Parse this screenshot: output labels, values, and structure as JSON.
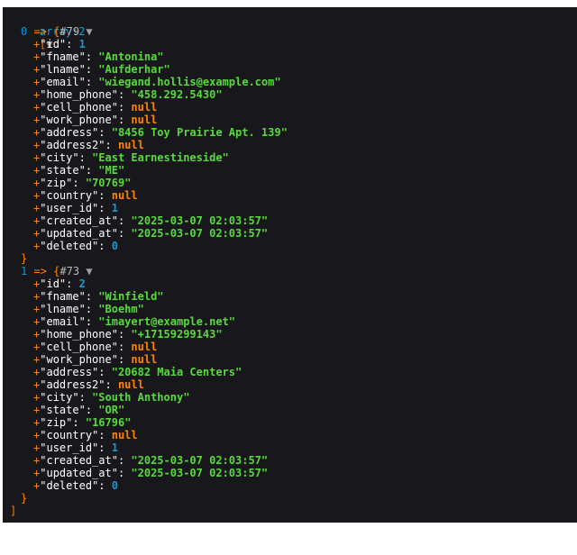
{
  "header": {
    "label": "array:2",
    "open_bracket": "[",
    "toggle": "▼",
    "close_bracket": "]"
  },
  "records": [
    {
      "index": "0",
      "arrow": "=>",
      "brace": "{",
      "ref": "#79",
      "toggle": "▼",
      "close": "}",
      "fields": [
        {
          "key": "id",
          "value": "1",
          "type": "num"
        },
        {
          "key": "fname",
          "value": "\"Antonina\"",
          "type": "str"
        },
        {
          "key": "lname",
          "value": "\"Aufderhar\"",
          "type": "str"
        },
        {
          "key": "email",
          "value": "\"wiegand.hollis@example.com\"",
          "type": "str"
        },
        {
          "key": "home_phone",
          "value": "\"458.292.5430\"",
          "type": "str"
        },
        {
          "key": "cell_phone",
          "value": "null",
          "type": "null"
        },
        {
          "key": "work_phone",
          "value": "null",
          "type": "null"
        },
        {
          "key": "address",
          "value": "\"8456 Toy Prairie Apt. 139\"",
          "type": "str"
        },
        {
          "key": "address2",
          "value": "null",
          "type": "null"
        },
        {
          "key": "city",
          "value": "\"East Earnestineside\"",
          "type": "str"
        },
        {
          "key": "state",
          "value": "\"ME\"",
          "type": "str"
        },
        {
          "key": "zip",
          "value": "\"70769\"",
          "type": "str"
        },
        {
          "key": "country",
          "value": "null",
          "type": "null"
        },
        {
          "key": "user_id",
          "value": "1",
          "type": "num"
        },
        {
          "key": "created_at",
          "value": "\"2025-03-07 02:03:57\"",
          "type": "str"
        },
        {
          "key": "updated_at",
          "value": "\"2025-03-07 02:03:57\"",
          "type": "str"
        },
        {
          "key": "deleted",
          "value": "0",
          "type": "num"
        }
      ]
    },
    {
      "index": "1",
      "arrow": "=>",
      "brace": "{",
      "ref": "#73",
      "toggle": "▼",
      "close": "}",
      "fields": [
        {
          "key": "id",
          "value": "2",
          "type": "num"
        },
        {
          "key": "fname",
          "value": "\"Winfield\"",
          "type": "str"
        },
        {
          "key": "lname",
          "value": "\"Boehm\"",
          "type": "str"
        },
        {
          "key": "email",
          "value": "\"imayert@example.net\"",
          "type": "str"
        },
        {
          "key": "home_phone",
          "value": "\"+17159299143\"",
          "type": "str"
        },
        {
          "key": "cell_phone",
          "value": "null",
          "type": "null"
        },
        {
          "key": "work_phone",
          "value": "null",
          "type": "null"
        },
        {
          "key": "address",
          "value": "\"20682 Maia Centers\"",
          "type": "str"
        },
        {
          "key": "address2",
          "value": "null",
          "type": "null"
        },
        {
          "key": "city",
          "value": "\"South Anthony\"",
          "type": "str"
        },
        {
          "key": "state",
          "value": "\"OR\"",
          "type": "str"
        },
        {
          "key": "zip",
          "value": "\"16796\"",
          "type": "str"
        },
        {
          "key": "country",
          "value": "null",
          "type": "null"
        },
        {
          "key": "user_id",
          "value": "1",
          "type": "num"
        },
        {
          "key": "created_at",
          "value": "\"2025-03-07 02:03:57\"",
          "type": "str"
        },
        {
          "key": "updated_at",
          "value": "\"2025-03-07 02:03:57\"",
          "type": "str"
        },
        {
          "key": "deleted",
          "value": "0",
          "type": "num"
        }
      ]
    }
  ],
  "colors": {
    "background": "#18171b",
    "string": "#56db3a",
    "number": "#1299da",
    "null": "#ff8400",
    "key": "#ffffff"
  }
}
